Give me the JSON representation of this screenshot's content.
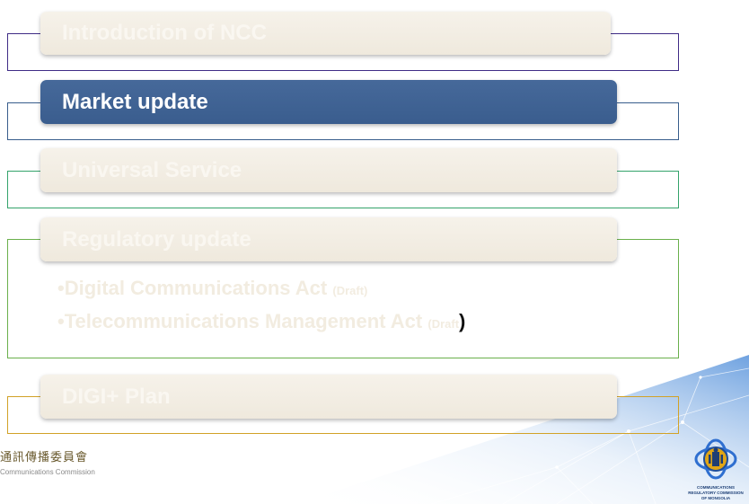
{
  "agenda": {
    "items": [
      {
        "label": "Introduction of NCC",
        "frame_color": "#3f2c86"
      },
      {
        "label": "Market update",
        "frame_color": "#385d8c",
        "active": true
      },
      {
        "label": "Universal Service",
        "frame_color": "#34a36b"
      },
      {
        "label": "Regulatory update",
        "frame_color": "#6ab04c"
      },
      {
        "label": "DIGI+  Plan",
        "frame_color": "#d2a227"
      }
    ],
    "regulatory_bullets": [
      {
        "bullet": "•",
        "text": "Digital Communications Act",
        "draft": "(Draft)",
        "close_paren": ""
      },
      {
        "bullet": "•",
        "text": "Telecommunications Management Act",
        "draft": "(Draft",
        "close_paren": ")"
      }
    ]
  },
  "footer": {
    "org_chinese": "通訊傳播委員會",
    "org_english": "Communications Commission"
  },
  "emblem": {
    "icon": "mongolia-crc-emblem-icon",
    "caption_line1": "COMMUNICATIONS",
    "caption_line2": "REGULATORY COMMISSION",
    "caption_line3": "OF MONGOLIA"
  },
  "colors": {
    "active_tab": "#3d6191",
    "inactive_tab": "#f3efe6",
    "inactive_text": "#faf7f1",
    "background_network": "#5b8fd6"
  }
}
